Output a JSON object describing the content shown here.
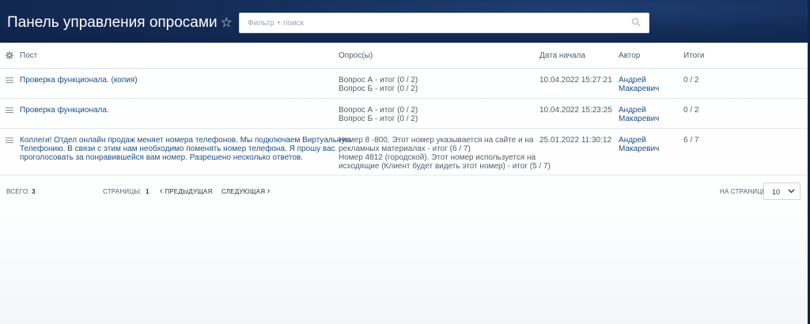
{
  "header": {
    "title": "Панель управления опросами",
    "star_icon": "star-icon",
    "search_placeholder": "Фильтр + поиск",
    "search_icon": "search-icon",
    "background_color": "#142d58"
  },
  "table": {
    "columns": {
      "settings_icon": "gear-icon",
      "post": "Пост",
      "polls": "Опрос(ы)",
      "start_date": "Дата начала",
      "author": "Автор",
      "results": "Итоги"
    },
    "rows": [
      {
        "post": "Проверка функционала. (копия)",
        "polls": [
          "Вопрос А - итог (0 / 2)",
          "Вопрос Б - итог (0 / 2)"
        ],
        "start_date": "10.04.2022 15:27:21",
        "author_first": "Андрей",
        "author_last": "Макаревич",
        "results": "0 / 2"
      },
      {
        "post": "Проверка функционала.",
        "polls": [
          "Вопрос А - итог (0 / 2)",
          "Вопрос Б - итог (0 / 2)"
        ],
        "start_date": "10.04.2022 15:23:25",
        "author_first": "Андрей",
        "author_last": "Макаревич",
        "results": "0 / 2"
      },
      {
        "post_lines": [
          "Коллеги! Отдел онлайн продаж меняет номера телефонов. Мы подключаем Виртуальную",
          "Телефонию. В связи с этим нам необходимо поменять номер телефона. Я прошу вас",
          "проголосовать за понравившейся вам номер. Разрешено несколько ответов."
        ],
        "polls_lines": [
          "Номер 8 -800. Этот номер указывается на сайте и на",
          "рекламных материалах - итог (6 / 7)",
          "Номер 4812 (городской). Этот номер используется на",
          "исходящие (Клиент будет видеть этот номер) - итог (5 / 7)"
        ],
        "start_date": "25.01.2022 11:30:12",
        "author_first": "Андрей",
        "author_last": "Макаревич",
        "results": "6 / 7"
      }
    ]
  },
  "footer": {
    "total_label": "ВСЕГО:",
    "total_value": "3",
    "pages_label": "СТРАНИЦЫ:",
    "pages_value": "1",
    "prev_label": "ПРЕДЫДУЩАЯ",
    "next_label": "СЛЕДУЮЩАЯ",
    "per_page_label": "НА СТРАНИЦЕ:",
    "per_page_value": "10"
  }
}
